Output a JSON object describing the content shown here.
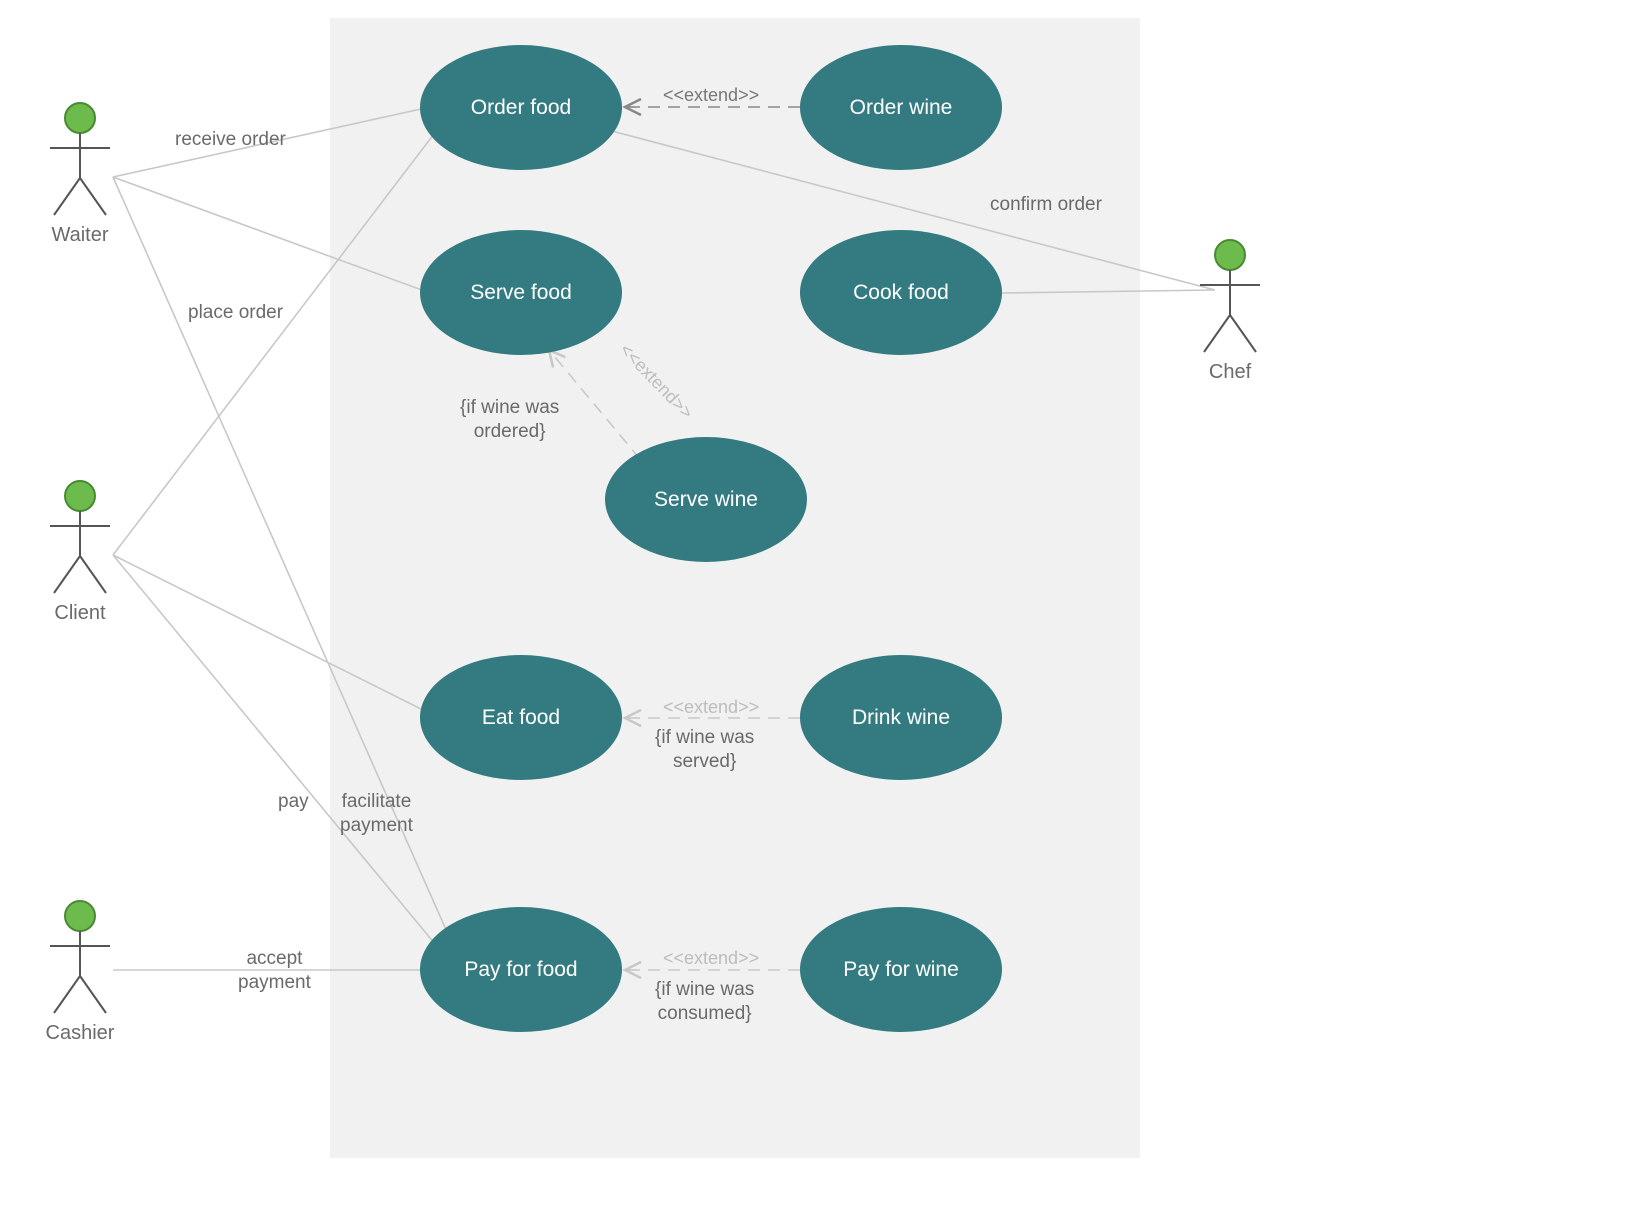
{
  "actors": {
    "waiter": "Waiter",
    "client": "Client",
    "cashier": "Cashier",
    "chef": "Chef"
  },
  "usecases": {
    "order_food": "Order food",
    "order_wine": "Order wine",
    "serve_food": "Serve food",
    "cook_food": "Cook food",
    "serve_wine": "Serve wine",
    "eat_food": "Eat food",
    "drink_wine": "Drink wine",
    "pay_for_food": "Pay for food",
    "pay_for_wine": "Pay for wine"
  },
  "association_labels": {
    "receive_order": "receive order",
    "place_order": "place order",
    "confirm_order": "confirm order",
    "facilitate_payment": "facilitate\npayment",
    "pay": "pay",
    "accept_payment": "accept\npayment"
  },
  "extend_labels": {
    "extend1": "<<extend>>",
    "extend2": "<<extend>>",
    "extend3": "<<extend>>",
    "extend4": "<<extend>>"
  },
  "guards": {
    "if_wine_ordered": "{if wine was\nordered}",
    "if_wine_served": "{if wine was\nserved}",
    "if_wine_consumed": "{if wine was\nconsumed}"
  },
  "colors": {
    "usecase_fill": "#337b81",
    "actor_head": "#6cbb4c",
    "background_box": "#f1f1f1",
    "line": "#c8c8c8"
  }
}
